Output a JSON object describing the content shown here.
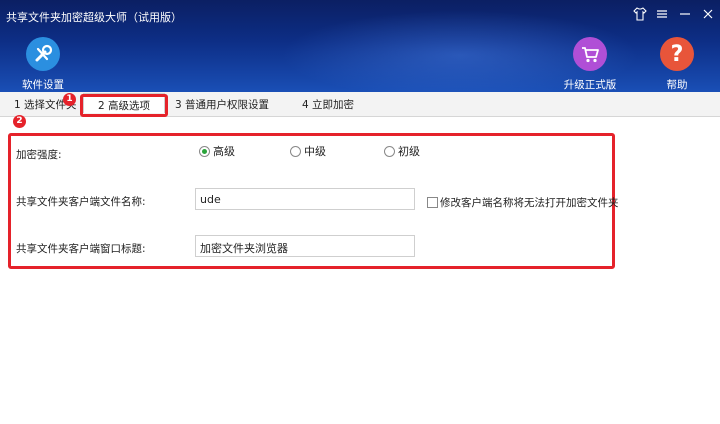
{
  "window": {
    "title": "共享文件夹加密超级大师（试用版）",
    "controls": [
      "shirt-icon",
      "menu-icon",
      "minimize-icon"
    ]
  },
  "toolbar": {
    "settings_label": "软件设置",
    "upgrade_label": "升级正式版",
    "help_label": "帮助",
    "help_glyph": "?"
  },
  "tabs": [
    {
      "label": "1 选择文件夹"
    },
    {
      "label": "2 高级选项",
      "active": true
    },
    {
      "label": "3 普通用户权限设置"
    },
    {
      "label": "4 立即加密"
    }
  ],
  "annotations": {
    "badge1": "1",
    "badge2": "2",
    "color": "#e5222a"
  },
  "form": {
    "strength_label": "加密强度:",
    "strength_options": [
      {
        "label": "高级",
        "selected": true
      },
      {
        "label": "中级",
        "selected": false
      },
      {
        "label": "初级",
        "selected": false
      }
    ],
    "client_name_label": "共享文件夹客户端文件名称:",
    "client_name_value": "ude",
    "rename_warning_label": "修改客户端名称将无法打开加密文件夹",
    "window_title_label": "共享文件夹客户端窗口标题:",
    "window_title_value": "加密文件夹浏览器"
  },
  "colors": {
    "header_top": "#0b1f63",
    "header_bottom": "#1a4fb6",
    "settings_icon": "#2b8fe0",
    "upgrade_icon": "#b04fd6",
    "help_icon": "#e8553a",
    "radio_on": "#2aa43a"
  }
}
